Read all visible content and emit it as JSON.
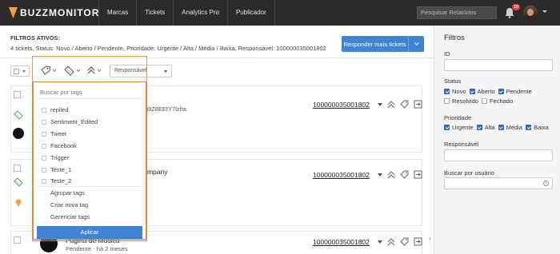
{
  "brand": {
    "name": "BUZZMONITOR",
    "accent": "#f0a03c"
  },
  "nav": {
    "items": [
      "Marcas",
      "Tickets",
      "Analytics Pro",
      "Publicador"
    ]
  },
  "header": {
    "search_placeholder": "Pesquisar Relatórios",
    "notification_count": "10"
  },
  "filters": {
    "title": "FILTROS ATIVOS:",
    "summary": "4 tickets, Status: Novo / Aberto / Pendente, Prioridade: Urgente / Alta / Média / Baixa, Responsável: 100000035001802",
    "reply_button": "Responder mais tickets"
  },
  "toolbar": {
    "responsavel_select": "Responsável"
  },
  "tag_dropdown": {
    "search_placeholder": "Buscar por tags",
    "tags": [
      "replied",
      "Sentiment_Edited",
      "Tweet",
      "Facebook",
      "Trigger",
      "Teste_1",
      "Teste_2"
    ],
    "actions": [
      "Agrupar tags",
      "Criar nova tag",
      "Gerenciar tags"
    ],
    "apply": "Aplicar"
  },
  "tickets": [
    {
      "snippet": "i4g9Z8EEtY7lzha",
      "id": "100000035001802"
    },
    {
      "snippet": "company",
      "id": "100000035001802"
    },
    {
      "title": "Pagina de Musica",
      "status": "Pendente - há 2 meses",
      "id": "100000035001802"
    }
  ],
  "sidebar": {
    "title": "Filtros",
    "id_label": "ID",
    "status_label": "Status",
    "status_options": [
      {
        "label": "Novo",
        "checked": true
      },
      {
        "label": "Aberto",
        "checked": true
      },
      {
        "label": "Pendente",
        "checked": true
      },
      {
        "label": "Resolvido",
        "checked": false
      },
      {
        "label": "Fechado",
        "checked": false
      }
    ],
    "priority_label": "Prioridade",
    "priority_options": [
      {
        "label": "Urgente",
        "checked": true
      },
      {
        "label": "Alta",
        "checked": true
      },
      {
        "label": "Média",
        "checked": true
      },
      {
        "label": "Baixa",
        "checked": true
      }
    ],
    "responsavel_label": "Responsável",
    "user_search_label": "Buscar por usuário"
  }
}
